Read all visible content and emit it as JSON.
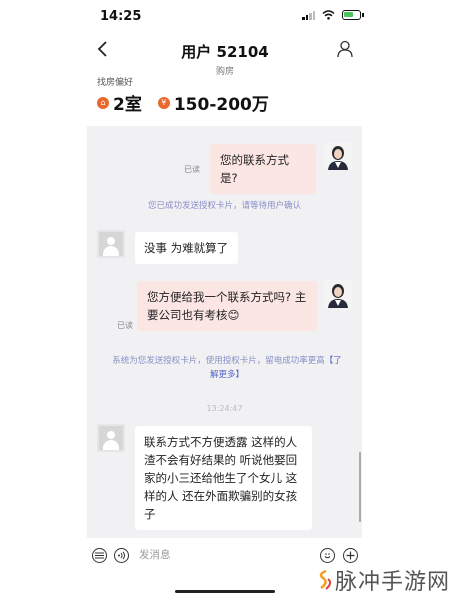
{
  "status_bar": {
    "time": "14:25"
  },
  "nav": {
    "title": "用户 52104",
    "subtitle": "购房"
  },
  "preference": {
    "label": "找房偏好",
    "rooms": "2室",
    "budget": "150-200万",
    "rooms_icon": "house-icon",
    "budget_icon": "price-icon"
  },
  "messages": {
    "m1_text": "您的联系方式是?",
    "m1_read": "已读",
    "sys1": "您已成功发送授权卡片，请等待用户确认",
    "m2_text": "没事 为难就算了",
    "m3_text": "您方便给我一个联系方式吗? 主要公司也有考核😊",
    "m3_read": "已读",
    "sys2_text": "系统为您发送授权卡片，使用授权卡片，留电成功率更高",
    "sys2_link": "【了解更多】",
    "timestamp": "13:24:47",
    "m4_text": "联系方式不方便透露 这样的人渣不会有好结果的 听说他娶回家的小三还给他生了个女儿 这样的人 还在外面欺骗别的女孩子"
  },
  "input": {
    "placeholder": "发消息"
  },
  "watermark": "脉冲手游网",
  "colors": {
    "accent_orange": "#e8692b",
    "outgoing_bubble": "#fbe6e4",
    "system_text": "#8a8fc8",
    "chat_bg": "#f1f1f3"
  }
}
